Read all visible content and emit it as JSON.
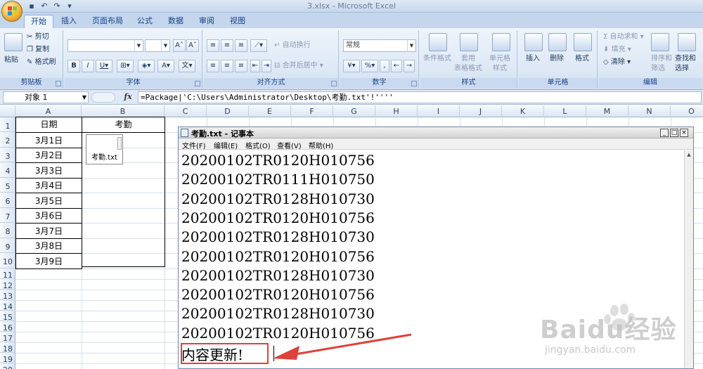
{
  "window": {
    "title": "3.xlsx - Microsoft Excel"
  },
  "tabs": [
    {
      "label": "开始",
      "active": true
    },
    {
      "label": "插入"
    },
    {
      "label": "页面布局"
    },
    {
      "label": "公式"
    },
    {
      "label": "数据"
    },
    {
      "label": "审阅"
    },
    {
      "label": "视图"
    }
  ],
  "ribbon": {
    "clipboard": {
      "label": "剪贴板",
      "paste": "粘贴",
      "cut": "剪切",
      "copy": "复制",
      "format_painter": "格式刷"
    },
    "font": {
      "label": "字体",
      "font_name": "",
      "font_size": ""
    },
    "alignment": {
      "label": "对齐方式",
      "wrap": "自动换行",
      "merge": "合并后居中"
    },
    "number": {
      "label": "数字",
      "format": "常规"
    },
    "styles": {
      "label": "样式",
      "conditional": "条件格式",
      "table_format": "套用\n表格格式",
      "cell_styles": "单元格\n样式"
    },
    "cells": {
      "label": "单元格",
      "insert": "插入",
      "delete": "删除",
      "format": "格式"
    },
    "editing": {
      "label": "编辑",
      "autosum": "自动求和",
      "fill": "填充",
      "clear": "清除",
      "sort": "排序和\n筛选",
      "find": "查找和\n选择"
    }
  },
  "formula_bar": {
    "name_box": "对象 1",
    "fx": "fx",
    "formula": "=Package|'C:\\Users\\Administrator\\Desktop\\考勤.txt'!''''"
  },
  "columns": [
    "A",
    "B",
    "C",
    "D",
    "E",
    "F",
    "G",
    "H",
    "I",
    "J",
    "K",
    "L",
    "M",
    "N",
    "O"
  ],
  "rows": [
    "1",
    "2",
    "3",
    "4",
    "5",
    "6",
    "7",
    "8",
    "9",
    "10",
    "11",
    "12",
    "13",
    "14",
    "15",
    "16",
    "17",
    "18",
    "19",
    "20"
  ],
  "sheet": {
    "header_a": "日期",
    "header_b": "考勤",
    "dates": [
      "3月1日",
      "3月2日",
      "3月3日",
      "3月4日",
      "3月5日",
      "3月6日",
      "3月7日",
      "3月8日",
      "3月9日"
    ],
    "object_label": "考勤.txt"
  },
  "notepad": {
    "title": "考勤.txt - 记事本",
    "menu": [
      "文件(F)",
      "编辑(E)",
      "格式(O)",
      "查看(V)",
      "帮助(H)"
    ],
    "lines": [
      "20200102TR0120H010756",
      "20200102TR0111H010750",
      "20200102TR0128H010730",
      "20200102TR0120H010756",
      "20200102TR0128H010730",
      "20200102TR0120H010756",
      "20200102TR0128H010730",
      "20200102TR0120H010756",
      "20200102TR0128H010730",
      "20200102TR0120H010756",
      "内容更新!"
    ]
  },
  "watermark": {
    "brand": "Baidu经验",
    "url": "jingyan.baidu.com"
  },
  "colors": {
    "accent": "#15428b",
    "highlight": "#e0403a"
  }
}
